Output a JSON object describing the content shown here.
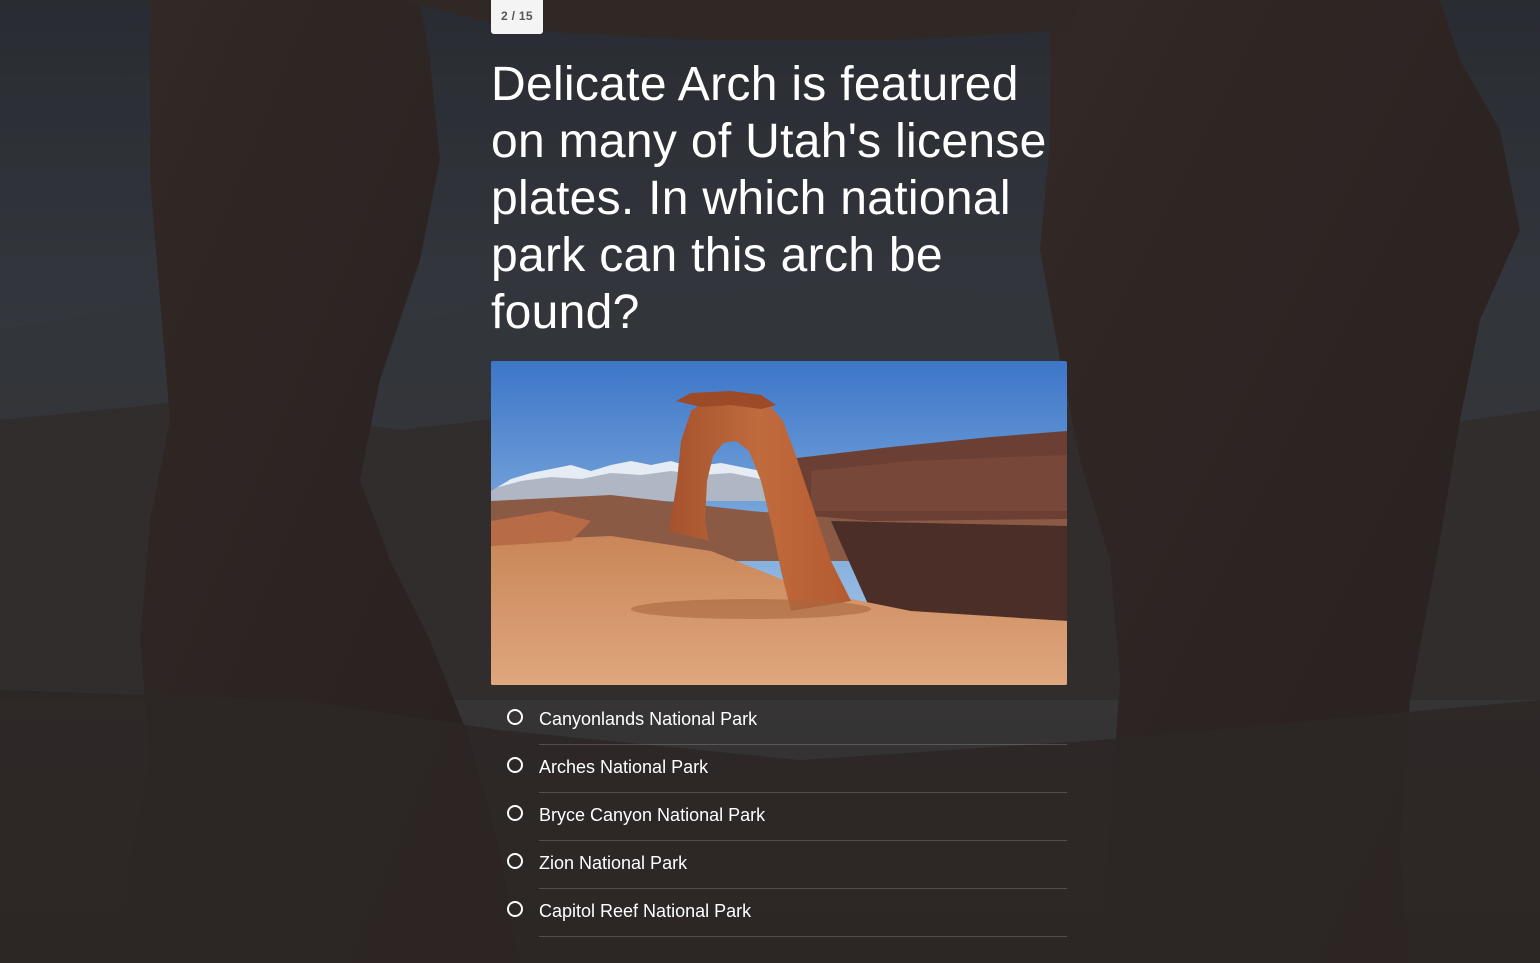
{
  "quiz": {
    "counter": "2 / 15",
    "question": "Delicate Arch is featured on many of Utah's license plates. In which national park can this arch be found?",
    "answers": [
      {
        "label": "Canyonlands National Park"
      },
      {
        "label": "Arches National Park"
      },
      {
        "label": "Bryce Canyon National Park"
      },
      {
        "label": "Zion National Park"
      },
      {
        "label": "Capitol Reef National Park"
      }
    ]
  },
  "icons": {
    "radio": "radio-unchecked-icon"
  },
  "colors": {
    "text": "#ffffff",
    "counter_bg": "#f4f4f4",
    "counter_text": "#555555"
  }
}
